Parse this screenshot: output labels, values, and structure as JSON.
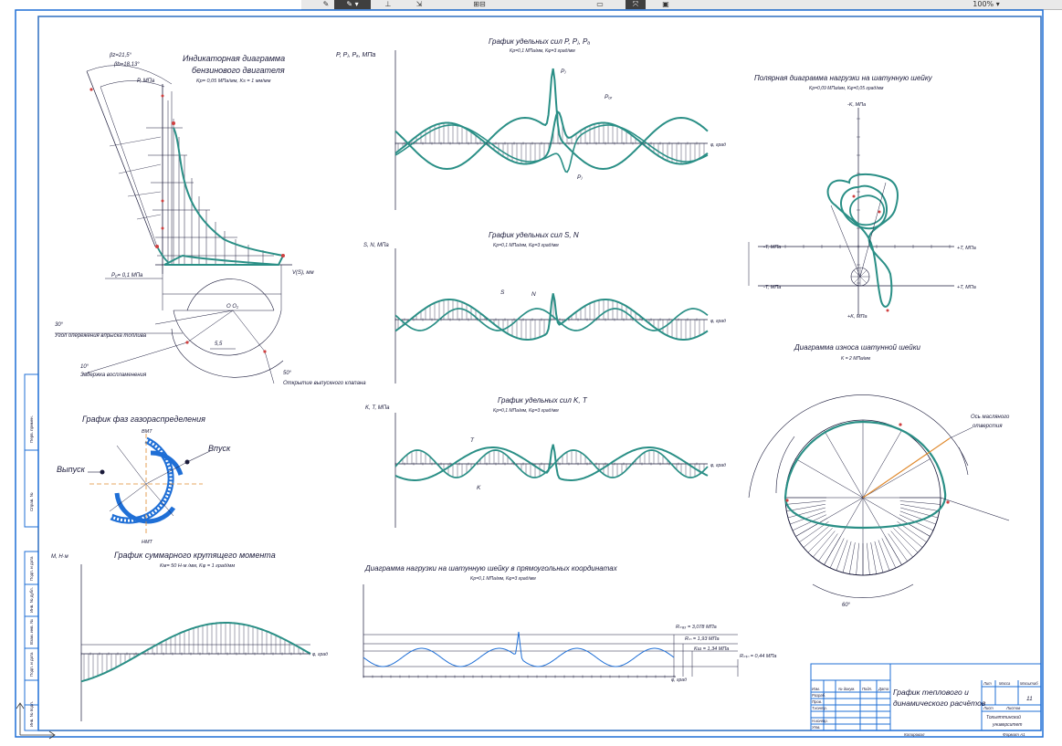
{
  "toolbar": {
    "zoom_label": "100% ▾",
    "icons": [
      "pencil-icon",
      "line-icon",
      "move-icon",
      "grid-icon",
      "select-icon",
      "cursor-icon",
      "print-icon"
    ]
  },
  "colors": {
    "frame": "#1f6fd6",
    "curve": "#2a8f86",
    "ink": "#1a1a3a",
    "accent": "#d04040",
    "orange": "#e08a2e"
  },
  "indicator": {
    "title": "Индикаторная диаграмма",
    "title2": "бензинового двигателя",
    "sub": "Kp= 0,05 МПа/мм, Ks = 1 мм/мм",
    "p0_label": "P₀= 0,1 МПа",
    "v_label": "V(S), мм",
    "p_label": "P, МПа",
    "ang1": "βz=21,5°",
    "ang2": "βb=18,13°"
  },
  "notes": {
    "n30": "30°",
    "n30_text": "Угол опережения впрыска топлива",
    "n10": "10°",
    "n10_text": "Задержка воспламенения",
    "n50": "50°",
    "n50_text": "Открытие выпускного клапана",
    "oo": "O O₁",
    "d55": "5,5"
  },
  "gas": {
    "title": "График фаз газораспределения",
    "inlet": "Впуск",
    "exhaust": "Выпуск",
    "tdc": "ВМТ",
    "bdc": "НМТ"
  },
  "torque": {
    "title": "График суммарного крутящего момента",
    "sub": "Kм= 50 Н·м /мм,  Kφ = 1 град/мм",
    "axis": "M, Н·м",
    "phi": "φ, град"
  },
  "forces_top": {
    "title": "График удельных сил P, Pⱼ, Pₐ",
    "sub": "Kp=0,1 МПа/мм,  Kφ=3 град/мм",
    "axis": "P, Pⱼ, Pₐ, МПа",
    "phi": "φ, град",
    "lab_pr": "Pⱼ",
    "lab_pz": "Pₒᵣ",
    "lab_pj": "Pⱼ"
  },
  "forces_sn": {
    "title": "График удельных сил S, N",
    "sub": "Kp=0,1 МПа/мм,  Kφ=3 град/мм",
    "axis": "S, N, МПа",
    "phi": "φ, град",
    "s": "S",
    "n": "N"
  },
  "forces_kt": {
    "title": "График удельных сил K, T",
    "sub": "Kp=0,1 МПа/мм,  Kφ=3 град/мм",
    "axis": "K, T, МПа",
    "phi": "φ, град",
    "k": "K",
    "t": "T"
  },
  "rect": {
    "title": "Диаграмма нагрузки на шатунную шейку в прямоугольных координатах",
    "sub": "Kp=0,1 МПа/мм,  Kφ=3 град/мм",
    "phi": "φ, град",
    "r1": "Rₘₐₓ = 3,078 МПа",
    "r2": "Rₘ = 1,93 МПа",
    "r3": "Kш = 1,34 МПа",
    "r4": "Rₘᵢₙ = 0,44 МПа"
  },
  "polar": {
    "title": "Полярная диаграмма нагрузки на шатунную шейку",
    "sub": "Kp=0,09 МПа/мм,  Kφ=0,05 град/мм",
    "kp": "+K, МПа",
    "km": "-K, МПа",
    "tp": "+T, МПа",
    "tm": "-T, МПа"
  },
  "wear": {
    "title": "Диаграмма износа шатунной шейки",
    "sub": "K = 2 МПа/мм",
    "oil": "Ось масляного",
    "oil2": "отверстия",
    "angle": "60°"
  },
  "stamp": {
    "title1": "График теплового и",
    "title2": "динамического расчётов",
    "sheet": "11",
    "lit": "Лит",
    "mass": "Масса",
    "scale": "Масштаб",
    "razrab": "Разраб.",
    "prov": "Пров.",
    "tkontr": "Т.контр.",
    "nkontr": "Н.контр.",
    "utv": "Утв.",
    "list": "Лист",
    "listov": "Листов",
    "izm": "Изм.",
    "ldoc": "№ докум.",
    "podp": "Подп.",
    "data": "Дата",
    "kopir": "Копировал",
    "format": "Формат A1",
    "org": "Тольяттинский",
    "org2": "университет"
  },
  "side": {
    "s1": "Перв. примен.",
    "s2": "Справ. №",
    "s3": "Подп. и дата",
    "s4": "Инв. № дубл.",
    "s5": "Взам. инв. №",
    "s6": "Подп. и дата",
    "s7": "Инв. № подл."
  }
}
